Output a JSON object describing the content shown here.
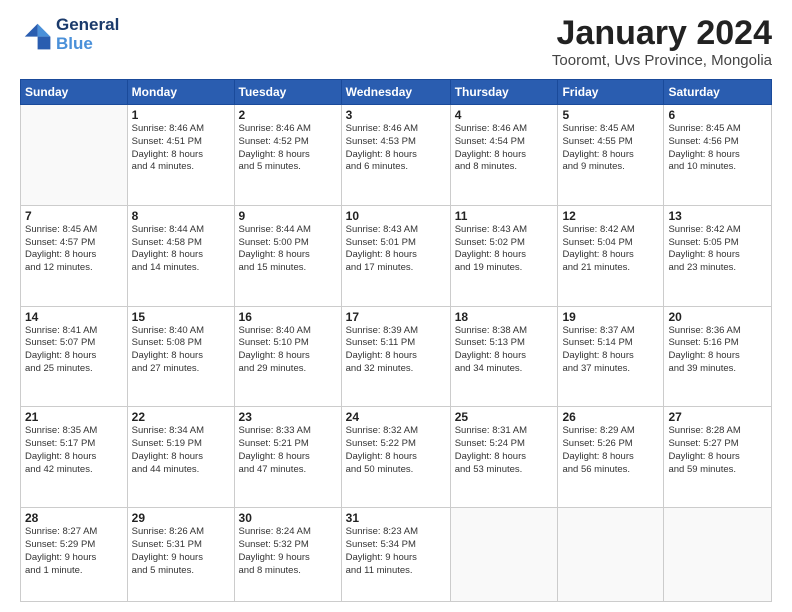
{
  "logo": {
    "line1": "General",
    "line2": "Blue"
  },
  "title": "January 2024",
  "subtitle": "Tooromt, Uvs Province, Mongolia",
  "days_header": [
    "Sunday",
    "Monday",
    "Tuesday",
    "Wednesday",
    "Thursday",
    "Friday",
    "Saturday"
  ],
  "weeks": [
    [
      {
        "day": "",
        "info": ""
      },
      {
        "day": "1",
        "info": "Sunrise: 8:46 AM\nSunset: 4:51 PM\nDaylight: 8 hours\nand 4 minutes."
      },
      {
        "day": "2",
        "info": "Sunrise: 8:46 AM\nSunset: 4:52 PM\nDaylight: 8 hours\nand 5 minutes."
      },
      {
        "day": "3",
        "info": "Sunrise: 8:46 AM\nSunset: 4:53 PM\nDaylight: 8 hours\nand 6 minutes."
      },
      {
        "day": "4",
        "info": "Sunrise: 8:46 AM\nSunset: 4:54 PM\nDaylight: 8 hours\nand 8 minutes."
      },
      {
        "day": "5",
        "info": "Sunrise: 8:45 AM\nSunset: 4:55 PM\nDaylight: 8 hours\nand 9 minutes."
      },
      {
        "day": "6",
        "info": "Sunrise: 8:45 AM\nSunset: 4:56 PM\nDaylight: 8 hours\nand 10 minutes."
      }
    ],
    [
      {
        "day": "7",
        "info": "Sunrise: 8:45 AM\nSunset: 4:57 PM\nDaylight: 8 hours\nand 12 minutes."
      },
      {
        "day": "8",
        "info": "Sunrise: 8:44 AM\nSunset: 4:58 PM\nDaylight: 8 hours\nand 14 minutes."
      },
      {
        "day": "9",
        "info": "Sunrise: 8:44 AM\nSunset: 5:00 PM\nDaylight: 8 hours\nand 15 minutes."
      },
      {
        "day": "10",
        "info": "Sunrise: 8:43 AM\nSunset: 5:01 PM\nDaylight: 8 hours\nand 17 minutes."
      },
      {
        "day": "11",
        "info": "Sunrise: 8:43 AM\nSunset: 5:02 PM\nDaylight: 8 hours\nand 19 minutes."
      },
      {
        "day": "12",
        "info": "Sunrise: 8:42 AM\nSunset: 5:04 PM\nDaylight: 8 hours\nand 21 minutes."
      },
      {
        "day": "13",
        "info": "Sunrise: 8:42 AM\nSunset: 5:05 PM\nDaylight: 8 hours\nand 23 minutes."
      }
    ],
    [
      {
        "day": "14",
        "info": "Sunrise: 8:41 AM\nSunset: 5:07 PM\nDaylight: 8 hours\nand 25 minutes."
      },
      {
        "day": "15",
        "info": "Sunrise: 8:40 AM\nSunset: 5:08 PM\nDaylight: 8 hours\nand 27 minutes."
      },
      {
        "day": "16",
        "info": "Sunrise: 8:40 AM\nSunset: 5:10 PM\nDaylight: 8 hours\nand 29 minutes."
      },
      {
        "day": "17",
        "info": "Sunrise: 8:39 AM\nSunset: 5:11 PM\nDaylight: 8 hours\nand 32 minutes."
      },
      {
        "day": "18",
        "info": "Sunrise: 8:38 AM\nSunset: 5:13 PM\nDaylight: 8 hours\nand 34 minutes."
      },
      {
        "day": "19",
        "info": "Sunrise: 8:37 AM\nSunset: 5:14 PM\nDaylight: 8 hours\nand 37 minutes."
      },
      {
        "day": "20",
        "info": "Sunrise: 8:36 AM\nSunset: 5:16 PM\nDaylight: 8 hours\nand 39 minutes."
      }
    ],
    [
      {
        "day": "21",
        "info": "Sunrise: 8:35 AM\nSunset: 5:17 PM\nDaylight: 8 hours\nand 42 minutes."
      },
      {
        "day": "22",
        "info": "Sunrise: 8:34 AM\nSunset: 5:19 PM\nDaylight: 8 hours\nand 44 minutes."
      },
      {
        "day": "23",
        "info": "Sunrise: 8:33 AM\nSunset: 5:21 PM\nDaylight: 8 hours\nand 47 minutes."
      },
      {
        "day": "24",
        "info": "Sunrise: 8:32 AM\nSunset: 5:22 PM\nDaylight: 8 hours\nand 50 minutes."
      },
      {
        "day": "25",
        "info": "Sunrise: 8:31 AM\nSunset: 5:24 PM\nDaylight: 8 hours\nand 53 minutes."
      },
      {
        "day": "26",
        "info": "Sunrise: 8:29 AM\nSunset: 5:26 PM\nDaylight: 8 hours\nand 56 minutes."
      },
      {
        "day": "27",
        "info": "Sunrise: 8:28 AM\nSunset: 5:27 PM\nDaylight: 8 hours\nand 59 minutes."
      }
    ],
    [
      {
        "day": "28",
        "info": "Sunrise: 8:27 AM\nSunset: 5:29 PM\nDaylight: 9 hours\nand 1 minute."
      },
      {
        "day": "29",
        "info": "Sunrise: 8:26 AM\nSunset: 5:31 PM\nDaylight: 9 hours\nand 5 minutes."
      },
      {
        "day": "30",
        "info": "Sunrise: 8:24 AM\nSunset: 5:32 PM\nDaylight: 9 hours\nand 8 minutes."
      },
      {
        "day": "31",
        "info": "Sunrise: 8:23 AM\nSunset: 5:34 PM\nDaylight: 9 hours\nand 11 minutes."
      },
      {
        "day": "",
        "info": ""
      },
      {
        "day": "",
        "info": ""
      },
      {
        "day": "",
        "info": ""
      }
    ]
  ]
}
